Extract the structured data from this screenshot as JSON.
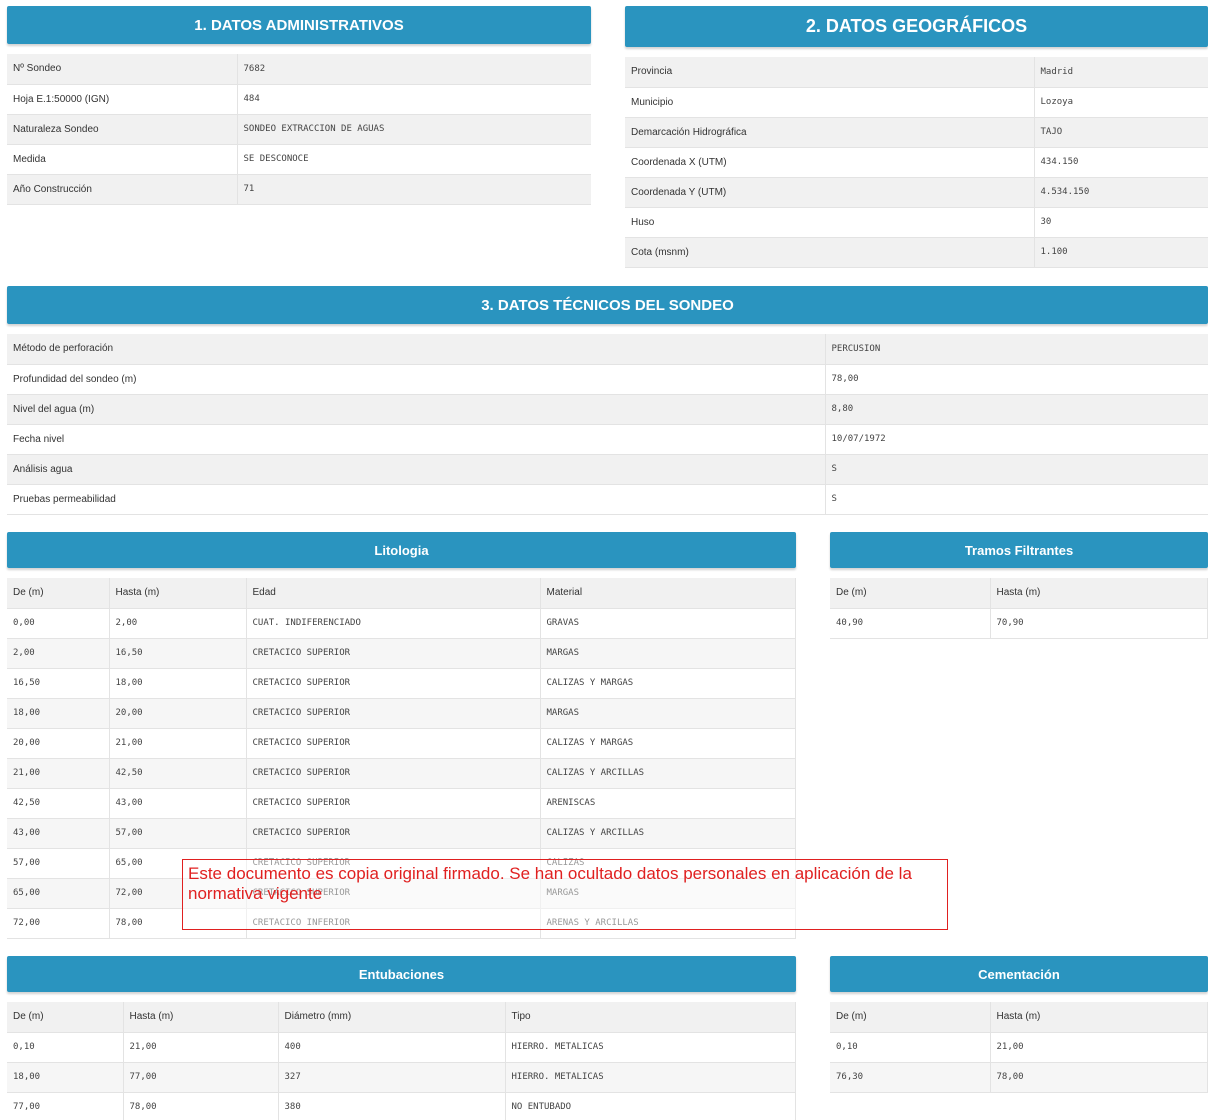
{
  "admin": {
    "title": "1. DATOS ADMINISTRATIVOS",
    "rows": [
      {
        "label": "Nº Sondeo",
        "value": "7682"
      },
      {
        "label": "Hoja E.1:50000 (IGN)",
        "value": "484"
      },
      {
        "label": "Naturaleza Sondeo",
        "value": "SONDEO EXTRACCION DE AGUAS"
      },
      {
        "label": "Medida",
        "value": "SE DESCONOCE"
      },
      {
        "label": "Año Construcción",
        "value": "71"
      }
    ]
  },
  "geo": {
    "title": "2. DATOS GEOGRÁFICOS",
    "rows": [
      {
        "label": "Provincia",
        "value": "Madrid"
      },
      {
        "label": "Municipio",
        "value": "Lozoya"
      },
      {
        "label": "Demarcación Hidrográfica",
        "value": "TAJO"
      },
      {
        "label": "Coordenada X (UTM)",
        "value": "434.150"
      },
      {
        "label": "Coordenada Y (UTM)",
        "value": "4.534.150"
      },
      {
        "label": "Huso",
        "value": "30"
      },
      {
        "label": "Cota (msnm)",
        "value": "1.100"
      }
    ]
  },
  "tecnico": {
    "title": "3. DATOS TÉCNICOS DEL SONDEO",
    "rows": [
      {
        "label": "Método de perforación",
        "value": "PERCUSION"
      },
      {
        "label": "Profundidad del sondeo (m)",
        "value": "78,00"
      },
      {
        "label": "Nivel del agua (m)",
        "value": "8,80"
      },
      {
        "label": "Fecha nivel",
        "value": "10/07/1972"
      },
      {
        "label": "Análisis agua",
        "value": "S"
      },
      {
        "label": "Pruebas permeabilidad",
        "value": "S"
      }
    ]
  },
  "litologia": {
    "title": "Litologia",
    "headers": [
      "De (m)",
      "Hasta (m)",
      "Edad",
      "Material"
    ],
    "rows": [
      [
        "0,00",
        "2,00",
        "CUAT. INDIFERENCIADO",
        "GRAVAS"
      ],
      [
        "2,00",
        "16,50",
        "CRETACICO SUPERIOR",
        "MARGAS"
      ],
      [
        "16,50",
        "18,00",
        "CRETACICO SUPERIOR",
        "CALIZAS Y MARGAS"
      ],
      [
        "18,00",
        "20,00",
        "CRETACICO SUPERIOR",
        "MARGAS"
      ],
      [
        "20,00",
        "21,00",
        "CRETACICO SUPERIOR",
        "CALIZAS Y MARGAS"
      ],
      [
        "21,00",
        "42,50",
        "CRETACICO SUPERIOR",
        "CALIZAS Y ARCILLAS"
      ],
      [
        "42,50",
        "43,00",
        "CRETACICO SUPERIOR",
        "ARENISCAS"
      ],
      [
        "43,00",
        "57,00",
        "CRETACICO SUPERIOR",
        "CALIZAS Y ARCILLAS"
      ],
      [
        "57,00",
        "65,00",
        "CRETACICO SUPERIOR",
        "CALIZAS"
      ],
      [
        "65,00",
        "72,00",
        "CRETACICO SUPERIOR",
        "MARGAS"
      ],
      [
        "72,00",
        "78,00",
        "CRETACICO INFERIOR",
        "ARENAS Y ARCILLAS"
      ]
    ]
  },
  "tramos": {
    "title": "Tramos Filtrantes",
    "headers": [
      "De (m)",
      "Hasta (m)"
    ],
    "rows": [
      [
        "40,90",
        "70,90"
      ]
    ]
  },
  "entubaciones": {
    "title": "Entubaciones",
    "headers": [
      "De (m)",
      "Hasta (m)",
      "Diámetro (mm)",
      "Tipo"
    ],
    "rows": [
      [
        "0,10",
        "21,00",
        "400",
        "HIERRO. METALICAS"
      ],
      [
        "18,00",
        "77,00",
        "327",
        "HIERRO. METALICAS"
      ],
      [
        "77,00",
        "78,00",
        "380",
        "NO ENTUBADO"
      ]
    ]
  },
  "cementacion": {
    "title": "Cementación",
    "headers": [
      "De (m)",
      "Hasta (m)"
    ],
    "rows": [
      [
        "0,10",
        "21,00"
      ],
      [
        "76,30",
        "78,00"
      ]
    ]
  },
  "stamp": {
    "text": "Este documento es copia original firmado. Se han ocultado datos personales en aplicación de la normativa vigente"
  },
  "colors": {
    "header_bg": "#2a94bf",
    "stamp": "#e02020"
  }
}
